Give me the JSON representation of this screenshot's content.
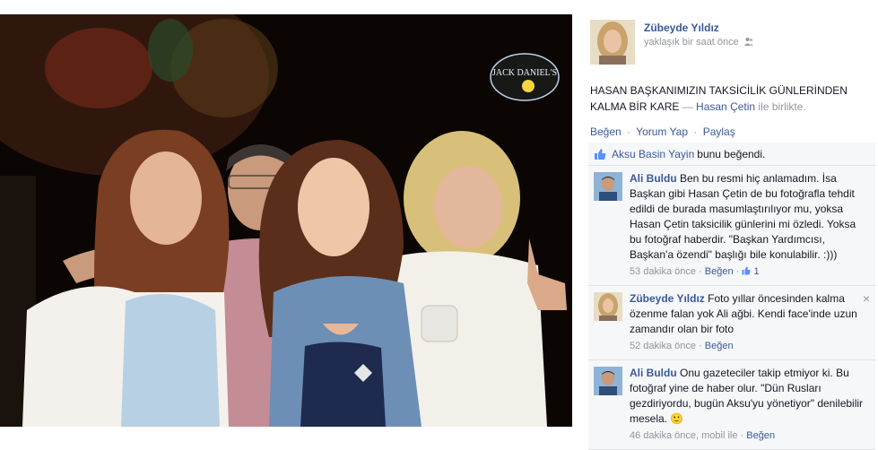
{
  "photo": {
    "alt_icons": [
      "jack-daniels-sign"
    ],
    "sign_text": "JACK DANIEL'S"
  },
  "post": {
    "owner_name": "Zübeyde Yıldız",
    "time": "yaklaşık bir saat önce",
    "caption_text": "HASAN BAŞKANIMIZIN TAKSİCİLİK GÜNLERİNDEN KALMA BİR KARE",
    "caption_dash": " — ",
    "tagged_name": "Hasan Çetin",
    "tagged_suffix": " ile birlikte.",
    "actions": {
      "like": "Beğen",
      "comment": "Yorum Yap",
      "share": "Paylaş",
      "separator": "·"
    },
    "likes": {
      "liker": "Aksu Basin Yayin",
      "suffix": "bunu beğendi."
    }
  },
  "comments": [
    {
      "author": "Ali Buldu",
      "text": " Ben bu resmi hiç anlamadım. İsa Başkan gibi Hasan Çetin de bu fotoğrafla tehdit edildi de burada masumlaştırılıyor mu, yoksa Hasan Çetin taksicilik günlerini mi özledi. Yoksa bu fotoğraf haberdir. \"Başkan Yardımcısı, Başkan'a özendi\" başlığı bile konulabilir. :)))",
      "time": "53 dakika önce",
      "sep": " · ",
      "like": "Beğen",
      "like_count": "1"
    },
    {
      "author": "Zübeyde Yıldız",
      "text": " Foto yıllar öncesinden kalma özenme falan yok Ali ağbi. Kendi face'inde uzun zamandır olan bir foto",
      "time": "52 dakika önce",
      "sep": " · ",
      "like": "Beğen",
      "close": "×"
    },
    {
      "author": "Ali Buldu",
      "text": " Onu gazeteciler takip etmiyor ki. Bu fotoğraf yine de haber olur. \"Dün Rusları gezdiriyordu, bugün Aksu'yu yönetiyor\" denilebilir mesela. ",
      "emoji": "🙂",
      "time": "46 dakika önce, mobil ile",
      "sep": " · ",
      "like": "Beğen"
    }
  ]
}
